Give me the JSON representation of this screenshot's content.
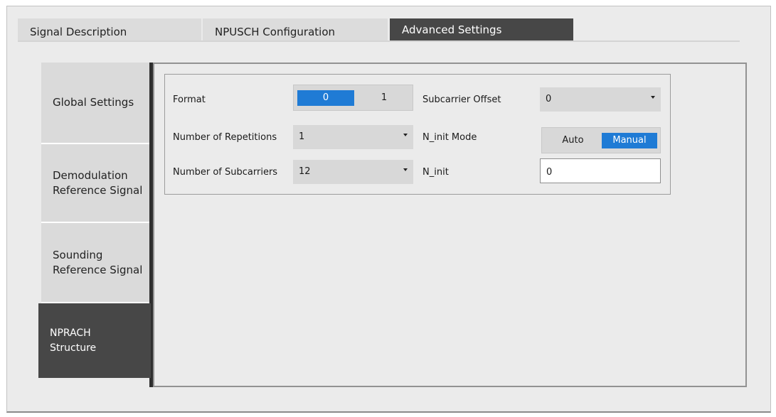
{
  "tabs": [
    {
      "label": "Signal Description",
      "active": false
    },
    {
      "label": "NPUSCH Configuration",
      "active": false
    },
    {
      "label": "Advanced Settings",
      "active": true
    }
  ],
  "side_tabs": [
    {
      "label_lines": [
        "Global Settings"
      ],
      "active": false
    },
    {
      "label_lines": [
        "Demodulation",
        "Reference Signal"
      ],
      "active": false
    },
    {
      "label_lines": [
        "Sounding",
        "Reference Signal"
      ],
      "active": false
    },
    {
      "label_lines": [
        "NPRACH",
        "Structure"
      ],
      "active": true
    }
  ],
  "settings": {
    "format": {
      "label": "Format",
      "options": [
        "0",
        "1"
      ],
      "selected": "0"
    },
    "subcarrier_offset": {
      "label": "Subcarrier Offset",
      "value": "0"
    },
    "number_of_repetitions": {
      "label": "Number of Repetitions",
      "value": "1"
    },
    "ninit_mode": {
      "label": "N_init Mode",
      "options": [
        "Auto",
        "Manual"
      ],
      "selected": "Manual"
    },
    "number_of_subcarriers": {
      "label": "Number of Subcarriers",
      "value": "12"
    },
    "ninit": {
      "label": "N_init",
      "value": "0"
    }
  },
  "colors": {
    "active_tab": "#474747",
    "selected_segment": "#1f7bd5",
    "background": "#ebebeb"
  }
}
